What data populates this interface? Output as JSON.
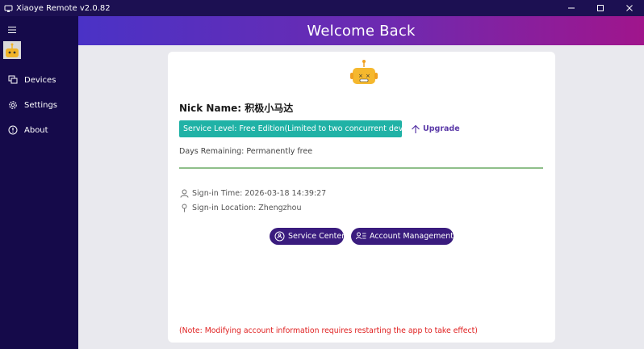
{
  "window": {
    "title": "Xiaoye Remote v2.0.82"
  },
  "sidebar": {
    "items": [
      {
        "label": "Devices",
        "icon": "devices-icon"
      },
      {
        "label": "Settings",
        "icon": "gear-icon"
      },
      {
        "label": "About",
        "icon": "info-icon"
      }
    ]
  },
  "header": {
    "title": "Welcome Back"
  },
  "profile": {
    "nick_label": "Nick Name:",
    "nick_value": "积极小马达",
    "service_level": "Service Level: Free Edition(Limited to two concurrent devices)",
    "upgrade_label": "Upgrade",
    "days_remaining": "Days Remaining: Permanently free",
    "signin_time": "Sign-in Time: 2026-03-18 14:39:27",
    "signin_location": "Sign-in Location: Zhengzhou"
  },
  "actions": {
    "service_center": "Service Center",
    "account_management": "Account Management"
  },
  "note": "(Note: Modifying account information requires restarting the app to take effect)",
  "colors": {
    "sidebar": "#150a4a",
    "titlebar": "#1c1052",
    "header_start": "#4a32c6",
    "header_end": "#a0158c",
    "badge": "#20b2a6",
    "button": "#3a1c7e",
    "note": "#e02020"
  }
}
